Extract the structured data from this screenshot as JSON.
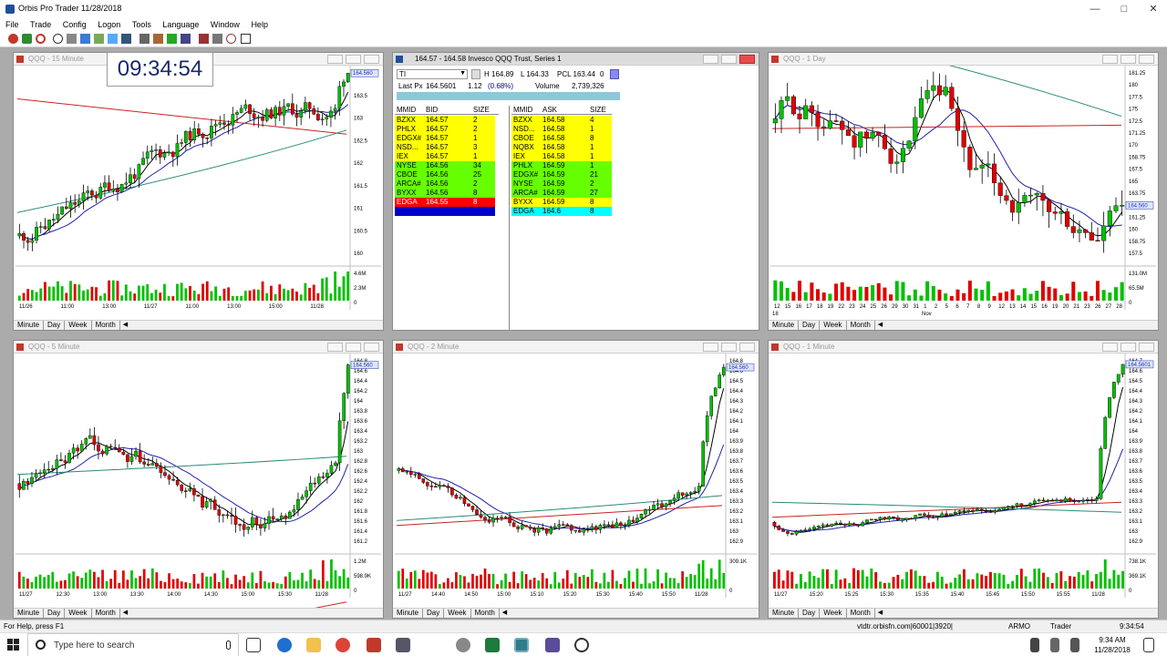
{
  "window": {
    "title": "Orbis Pro Trader  11/28/2018"
  },
  "menu": [
    "File",
    "Trade",
    "Config",
    "Logon",
    "Tools",
    "Language",
    "Window",
    "Help"
  ],
  "clock": "09:34:54",
  "colors": {
    "up": "#00c000",
    "down": "#e00000",
    "workspace": "#ababab",
    "green_row": "#66ff00",
    "yellow_row": "#ffff00",
    "red_row": "#ff0000",
    "blue_row": "#0000cc",
    "cyan_row": "#00ffff"
  },
  "panels": {
    "p15": {
      "title": "QQQ - 15 Minute",
      "last_tag": "164.560",
      "yticks": [
        "164",
        "163.5",
        "163",
        "162.5",
        "162",
        "161.5",
        "161",
        "160.5",
        "160"
      ],
      "vol": [
        "4.6M",
        "2.3M",
        "0"
      ],
      "xticks": [
        "11/26",
        "11:00",
        "13:00",
        "11/27",
        "11:00",
        "13:00",
        "15:00",
        "11/28"
      ]
    },
    "p1d": {
      "title": "QQQ - 1 Day",
      "last_tag": "164.560",
      "yticks": [
        "181.25",
        "180",
        "177.5",
        "175",
        "172.5",
        "171.25",
        "170",
        "168.75",
        "167.5",
        "165",
        "163.75",
        "162.5",
        "161.25",
        "160",
        "158.75",
        "157.5"
      ],
      "vol": [
        "131.0M",
        "65.5M",
        "0"
      ],
      "xticks": [
        "12",
        "15",
        "16",
        "17",
        "18",
        "19",
        "22",
        "23",
        "24",
        "25",
        "26",
        "29",
        "30",
        "31",
        "1",
        "2",
        "5",
        "6",
        "7",
        "8",
        "9",
        "12",
        "13",
        "14",
        "15",
        "16",
        "19",
        "20",
        "21",
        "23",
        "26",
        "27",
        "28"
      ],
      "xsub": [
        "18",
        "Nov"
      ]
    },
    "p5": {
      "title": "QQQ - 5 Minute",
      "last_tag": "164.560",
      "yticks": [
        "164.8",
        "164.6",
        "164.4",
        "164.2",
        "164",
        "163.8",
        "163.6",
        "163.4",
        "163.2",
        "163",
        "162.8",
        "162.6",
        "162.4",
        "162.2",
        "162",
        "161.8",
        "161.6",
        "161.4",
        "161.2"
      ],
      "vol": [
        "1.2M",
        "598.9K",
        "0"
      ],
      "xticks": [
        "11/27",
        "12:30",
        "13:00",
        "13:30",
        "14:00",
        "14:30",
        "15:00",
        "15:30",
        "11/28"
      ]
    },
    "p2": {
      "title": "QQQ - 2 Minute",
      "last_tag": "164.560",
      "yticks": [
        "164.8",
        "164.6",
        "164.5",
        "164.4",
        "164.3",
        "164.2",
        "164.1",
        "164",
        "163.9",
        "163.8",
        "163.7",
        "163.6",
        "163.5",
        "163.4",
        "163.3",
        "163.2",
        "163.1",
        "163",
        "162.9"
      ],
      "vol": [
        "309.1K",
        "0"
      ],
      "xticks": [
        "11/27",
        "14:40",
        "14:50",
        "15:00",
        "15:10",
        "15:20",
        "15:30",
        "15:40",
        "15:50",
        "11/28"
      ]
    },
    "p1": {
      "title": "QQQ - 1 Minute",
      "last_tag": "164.5601",
      "yticks": [
        "164.7",
        "164.6",
        "164.5",
        "164.4",
        "164.3",
        "164.2",
        "164.1",
        "164",
        "163.9",
        "163.8",
        "163.7",
        "163.6",
        "163.5",
        "163.4",
        "163.3",
        "163.2",
        "163.1",
        "163",
        "162.9"
      ],
      "vol": [
        "738.1K",
        "369.1K",
        "0"
      ],
      "xticks": [
        "11/27",
        "15:20",
        "15:25",
        "15:30",
        "15:35",
        "15:40",
        "15:45",
        "15:50",
        "15:55",
        "11/28"
      ]
    }
  },
  "tabs": [
    "Minute",
    "Day",
    "Week",
    "Month"
  ],
  "level2": {
    "title": "164.57 - 164.58   Invesco QQQ Trust, Series 1",
    "symbol": "TI",
    "high": "H 164.89",
    "low": "L 164.33",
    "pcl": "PCL 163.44",
    "zero": "0",
    "last_label": "Last Px",
    "last": "164.5601",
    "change": "1.12",
    "pct": "(0.68%)",
    "volume_label": "Volume",
    "volume": "2,739,326",
    "bid_headers": [
      "MMID",
      "BID",
      "SIZE"
    ],
    "ask_headers": [
      "MMID",
      "ASK",
      "SIZE"
    ],
    "bids": [
      {
        "mmid": "BZXX",
        "px": "164.57",
        "size": "2",
        "color": "#ffff00"
      },
      {
        "mmid": "PHLX",
        "px": "164.57",
        "size": "2",
        "color": "#ffff00"
      },
      {
        "mmid": "EDGX#",
        "px": "164.57",
        "size": "1",
        "color": "#ffff00"
      },
      {
        "mmid": "NSD...",
        "px": "164.57",
        "size": "3",
        "color": "#ffff00"
      },
      {
        "mmid": "IEX",
        "px": "164.57",
        "size": "1",
        "color": "#ffff00"
      },
      {
        "mmid": "NYSE",
        "px": "164.56",
        "size": "34",
        "color": "#66ff00"
      },
      {
        "mmid": "CBOE",
        "px": "164.56",
        "size": "25",
        "color": "#66ff00"
      },
      {
        "mmid": "ARCA#",
        "px": "164.56",
        "size": "2",
        "color": "#66ff00"
      },
      {
        "mmid": "BYXX",
        "px": "164.56",
        "size": "8",
        "color": "#66ff00"
      },
      {
        "mmid": "EDGA",
        "px": "164.55",
        "size": "8",
        "color": "#ff0000"
      },
      {
        "mmid": "",
        "px": "",
        "size": "",
        "color": "#0000cc"
      }
    ],
    "asks": [
      {
        "mmid": "BZXX",
        "px": "164.58",
        "size": "4",
        "color": "#ffff00"
      },
      {
        "mmid": "NSD...",
        "px": "164.58",
        "size": "1",
        "color": "#ffff00"
      },
      {
        "mmid": "CBOE",
        "px": "164.58",
        "size": "8",
        "color": "#ffff00"
      },
      {
        "mmid": "NQBX",
        "px": "164.58",
        "size": "1",
        "color": "#ffff00"
      },
      {
        "mmid": "IEX",
        "px": "164.58",
        "size": "1",
        "color": "#ffff00"
      },
      {
        "mmid": "PHLX",
        "px": "164.59",
        "size": "1",
        "color": "#66ff00"
      },
      {
        "mmid": "EDGX#",
        "px": "164.59",
        "size": "21",
        "color": "#66ff00"
      },
      {
        "mmid": "NYSE",
        "px": "164.59",
        "size": "2",
        "color": "#66ff00"
      },
      {
        "mmid": "ARCA#",
        "px": "164.59",
        "size": "27",
        "color": "#66ff00"
      },
      {
        "mmid": "BYXX",
        "px": "164.59",
        "size": "8",
        "color": "#ffff00"
      },
      {
        "mmid": "EDGA",
        "px": "164.6",
        "size": "8",
        "color": "#00ffff"
      }
    ]
  },
  "status": {
    "help": "For Help, press F1",
    "server": "vtdtr.orbisfn.com|60001|3920|",
    "account": "ARMO",
    "role": "Trader",
    "time": "9:34:54"
  },
  "taskbar": {
    "search_placeholder": "Type here to search",
    "time": "9:34 AM",
    "date": "11/28/2018"
  }
}
